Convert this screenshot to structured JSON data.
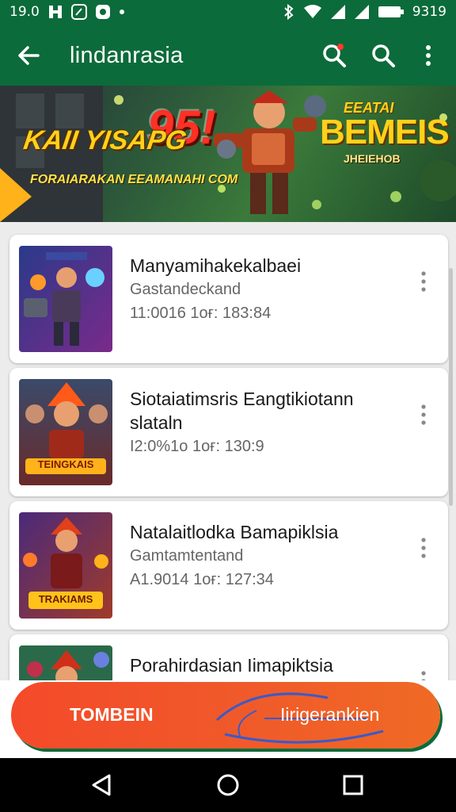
{
  "status_bar": {
    "time": "19.0",
    "battery_time": "9319"
  },
  "app_bar": {
    "title": "lindanrasia"
  },
  "banner": {
    "headline": "KAII YISAPG",
    "score": "95!",
    "subtitle": "FORAIARAKAN EEAMANAHI COM",
    "logo_top": "EEATAI",
    "logo_main": "BEMEIS",
    "logo_sub": "JHEIEHOB"
  },
  "items": [
    {
      "title": "Manyamihakekalbaei",
      "subtitle": "Gastandeckand",
      "meta": "11:0016 1oғ: 183:84"
    },
    {
      "title": "Siotaiatimsris Eangtikiotann slataln",
      "subtitle": "",
      "meta": "I2:0%1o 1oғ: 130:9"
    },
    {
      "title": "Natalaitlodka Bamapiklsia",
      "subtitle": "Gamtamtentand",
      "meta": "A1.9014 1oғ: 127:34"
    },
    {
      "title": "Porahirdasian Iimapiktsia",
      "subtitle": "",
      "meta": ""
    }
  ],
  "thumb_captions": [
    "",
    "TEINGKAIS",
    "TRAKIAMS"
  ],
  "cta": {
    "left_label": "TOMBEIN",
    "right_label": "Iirigerankien"
  },
  "colors": {
    "primary": "#0c6b3a",
    "accent": "#f44a2a"
  }
}
